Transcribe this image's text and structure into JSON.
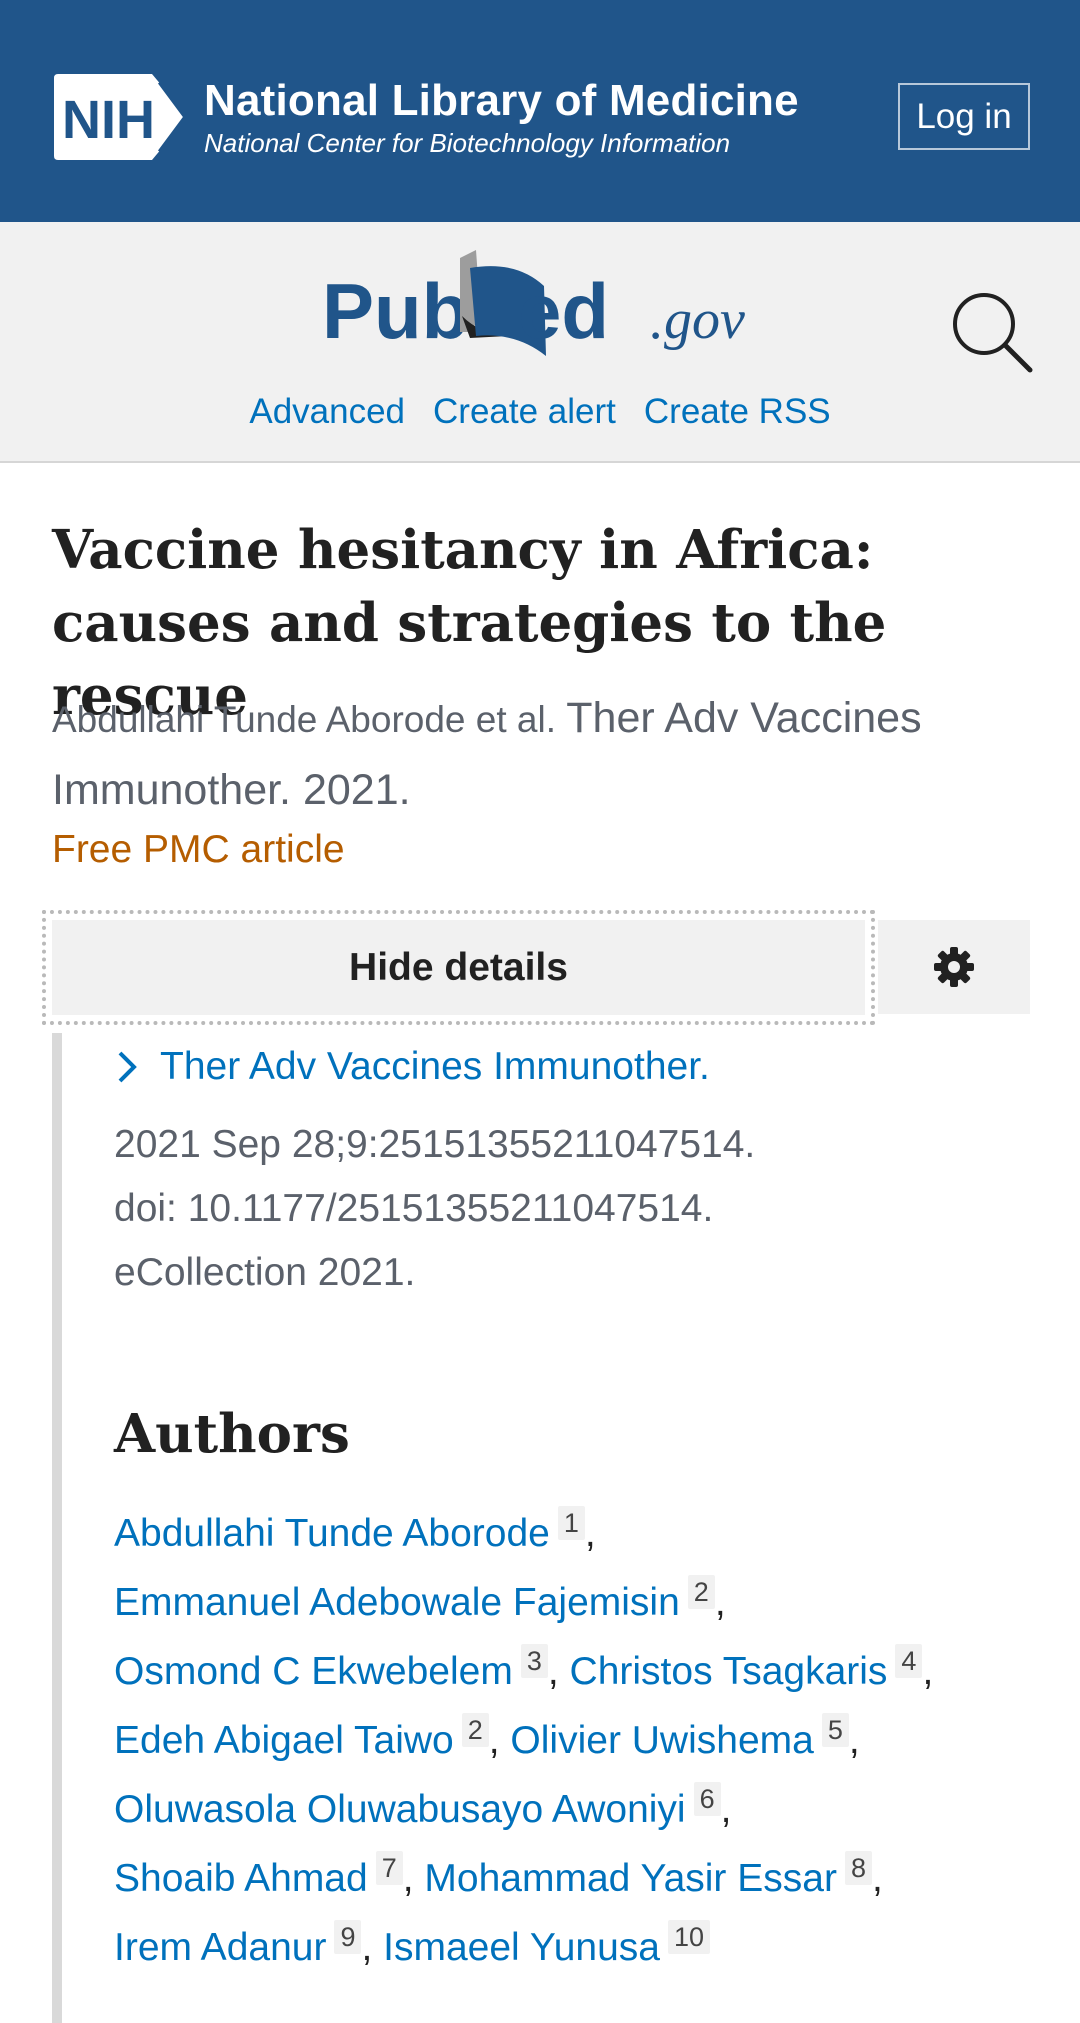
{
  "nih_header": {
    "logo_text": "NIH",
    "title": "National Library of Medicine",
    "subtitle": "National Center for Biotechnology Information",
    "login_label": "Log in",
    "background": "#20558a"
  },
  "pubmed_header": {
    "logo_text": "PubMed.gov",
    "links": [
      "Advanced",
      "Create alert",
      "Create RSS"
    ],
    "search_icon": "search-icon"
  },
  "article": {
    "title": "Vaccine hesitancy in Africa: causes and strategies to the rescue",
    "citation_authors": "Abdullahi Tunde Aborode et al.",
    "citation_journal": "Ther Adv Vaccines Immunother. 2021.",
    "free_label": "Free PMC article",
    "hide_details_label": "Hide details",
    "settings_icon": "gear-icon",
    "journal_link": "Ther Adv Vaccines Immunother.",
    "pub_date": "2021 Sep 28;9:25151355211047514.",
    "doi": "doi: 10.1177/25151355211047514.",
    "ecollection": "eCollection 2021."
  },
  "authors": {
    "heading": "Authors",
    "list": [
      {
        "name": "Abdullahi Tunde Aborode",
        "aff": "1"
      },
      {
        "name": "Emmanuel Adebowale Fajemisin",
        "aff": "2"
      },
      {
        "name": "Osmond C Ekwebelem",
        "aff": "3"
      },
      {
        "name": "Christos Tsagkaris",
        "aff": "4"
      },
      {
        "name": "Edeh Abigael Taiwo",
        "aff": "2"
      },
      {
        "name": "Olivier Uwishema",
        "aff": "5"
      },
      {
        "name": "Oluwasola Oluwabusayo Awoniyi",
        "aff": "6"
      },
      {
        "name": "Shoaib Ahmad",
        "aff": "7"
      },
      {
        "name": "Mohammad Yasir Essar",
        "aff": "8"
      },
      {
        "name": "Irem Adanur",
        "aff": "9"
      },
      {
        "name": "Ismaeel Yunusa",
        "aff": "10"
      }
    ]
  },
  "colors": {
    "link": "#0071bc",
    "free_article": "#b55d00",
    "header_bg": "#20558a"
  }
}
